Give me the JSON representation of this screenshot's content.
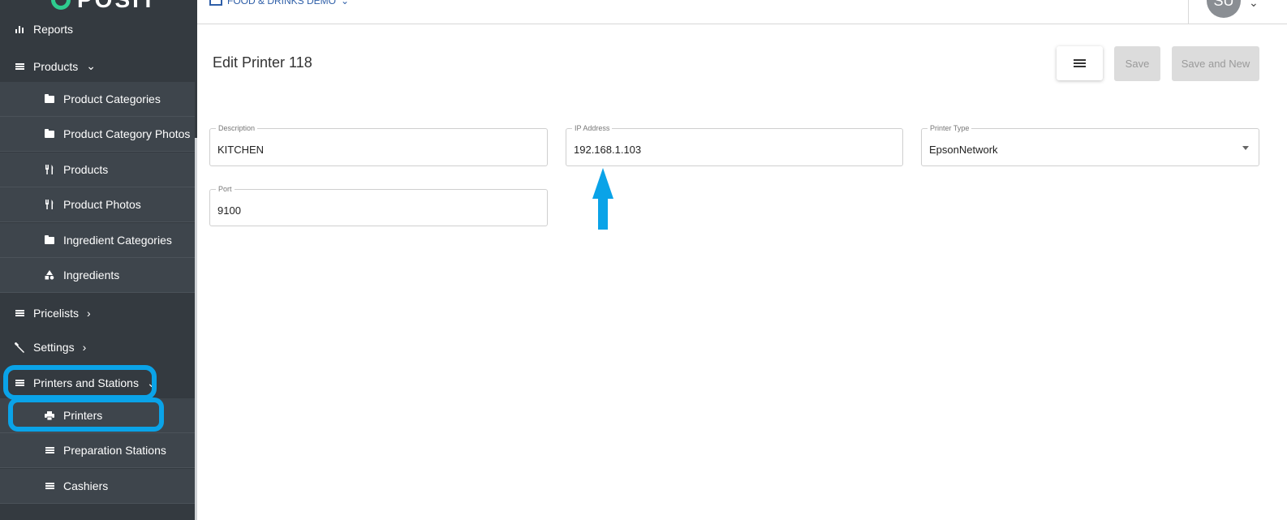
{
  "brand": {
    "name": "POSIT"
  },
  "sidebar": {
    "items": [
      {
        "label": "Reports",
        "icon": "bar-chart-icon"
      },
      {
        "label": "Products",
        "icon": "list-icon"
      },
      {
        "label": "Product Categories",
        "icon": "folder-icon"
      },
      {
        "label": "Product Category Photos",
        "icon": "folder-icon"
      },
      {
        "label": "Products",
        "icon": "utensils-icon"
      },
      {
        "label": "Product Photos",
        "icon": "utensils-icon"
      },
      {
        "label": "Ingredient Categories",
        "icon": "folder-icon"
      },
      {
        "label": "Ingredients",
        "icon": "shapes-icon"
      },
      {
        "label": "Pricelists",
        "icon": "list-icon"
      },
      {
        "label": "Settings",
        "icon": "wrench-icon"
      },
      {
        "label": "Printers and Stations",
        "icon": "list-icon"
      },
      {
        "label": "Printers",
        "icon": "printer-icon"
      },
      {
        "label": "Preparation Stations",
        "icon": "list-icon"
      },
      {
        "label": "Cashiers",
        "icon": "list-icon"
      }
    ]
  },
  "topbar": {
    "store_name": "FOOD & DRINKS DEMO",
    "user_initials": "SU"
  },
  "main": {
    "title": "Edit Printer 118",
    "buttons": {
      "save": "Save",
      "save_and_new": "Save and New"
    },
    "fields": {
      "description": {
        "label": "Description",
        "value": "KITCHEN"
      },
      "ip_address": {
        "label": "IP Address",
        "value": "192.168.1.103"
      },
      "printer_type": {
        "label": "Printer Type",
        "value": "EpsonNetwork"
      },
      "port": {
        "label": "Port",
        "value": "9100"
      }
    }
  },
  "colors": {
    "sidebar_bg": "#343a40",
    "highlight": "#0aa3e8",
    "accent": "#2f5fa8"
  }
}
